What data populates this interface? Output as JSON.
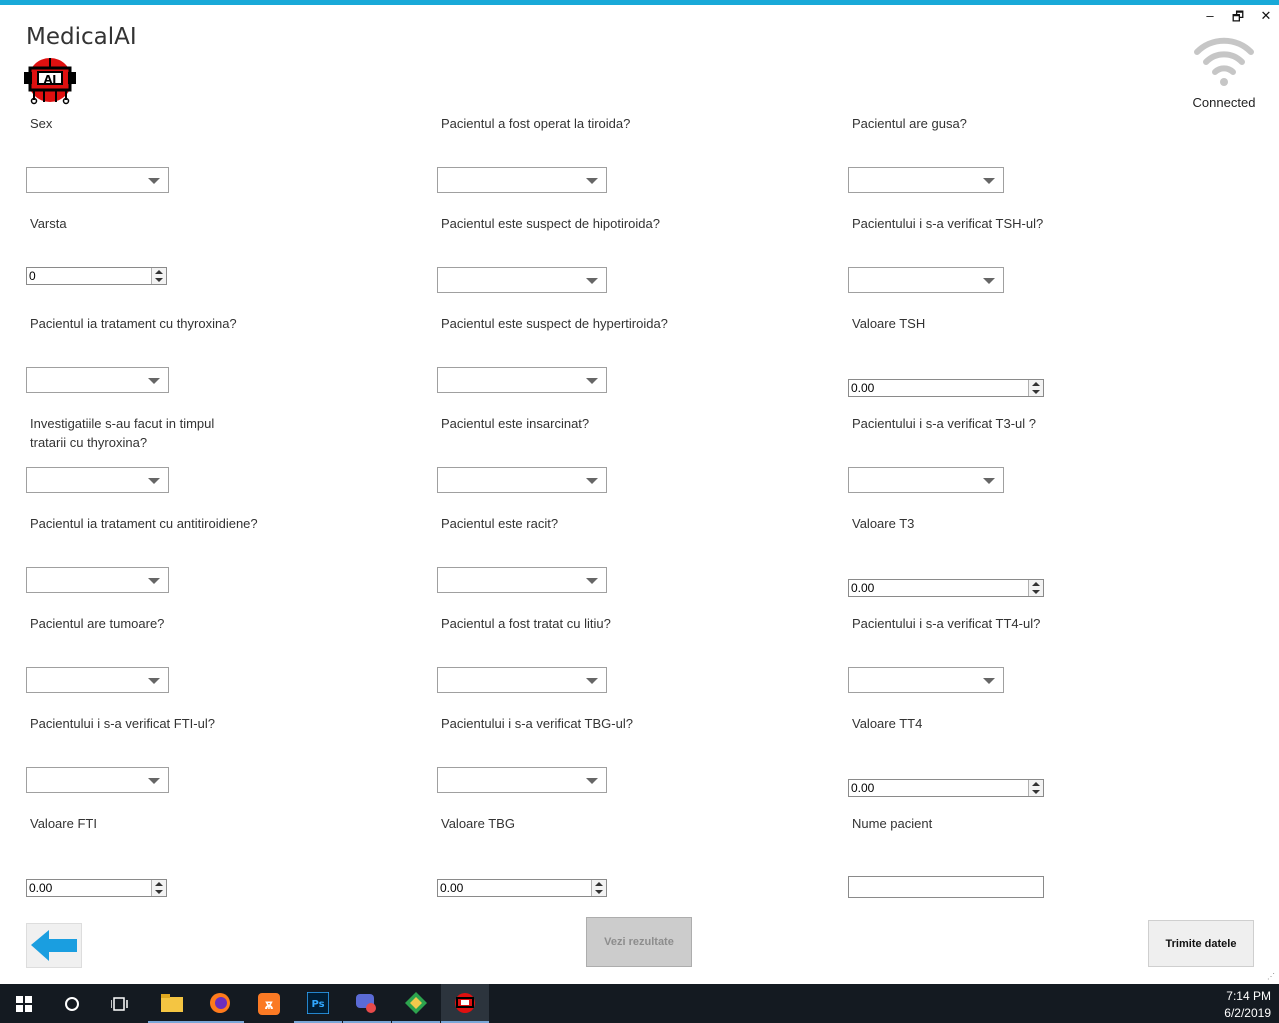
{
  "app": {
    "title": "MedicalAI"
  },
  "window_controls": {
    "minimize": "–",
    "restore": "🗗",
    "close": "✕"
  },
  "connection": {
    "status": "Connected"
  },
  "form": {
    "labels": {
      "sex": "Sex",
      "varsta": "Varsta",
      "thyroxina": "Pacientul ia tratament cu thyroxina?",
      "investigatii": "Investigatiile s-au facut in timpul tratarii cu thyroxina?",
      "antitiroidiene": "Pacientul ia tratament cu antitiroidiene?",
      "tumoare": "Pacientul are tumoare?",
      "fti_checked": "Pacientului i s-a verificat FTI-ul?",
      "fti_value": "Valoare FTI",
      "operat": "Pacientul a fost operat la tiroida?",
      "hipotiroida": "Pacientul este suspect de hipotiroida?",
      "hipertiroida": "Pacientul este suspect de hypertiroida?",
      "insarcinat": "Pacientul este insarcinat?",
      "racit": "Pacientul este racit?",
      "litiu": "Pacientul a fost tratat cu litiu?",
      "tbg_checked": "Pacientului i s-a verificat TBG-ul?",
      "tbg_value": "Valoare TBG",
      "gusa": "Pacientul are gusa?",
      "tsh_checked": "Pacientului i s-a verificat TSH-ul?",
      "tsh_value": "Valoare TSH",
      "t3_checked": "Pacientului i s-a verificat T3-ul ?",
      "t3_value": "Valoare T3",
      "tt4_checked": "Pacientului i s-a verificat TT4-ul?",
      "tt4_value": "Valoare TT4",
      "nume": "Nume pacient"
    },
    "values": {
      "varsta": "0",
      "tsh": "0.00",
      "t3": "0.00",
      "tt4": "0.00",
      "fti": "0.00",
      "tbg": "0.00",
      "nume": ""
    }
  },
  "buttons": {
    "vezi": "Vezi rezultate",
    "trimite": "Trimite datele"
  },
  "taskbar": {
    "time": "7:14 PM",
    "date": "6/2/2019"
  },
  "colors": {
    "accent": "#19a9d8",
    "back_arrow": "#1a9ee0",
    "taskbar": "#141a21"
  }
}
